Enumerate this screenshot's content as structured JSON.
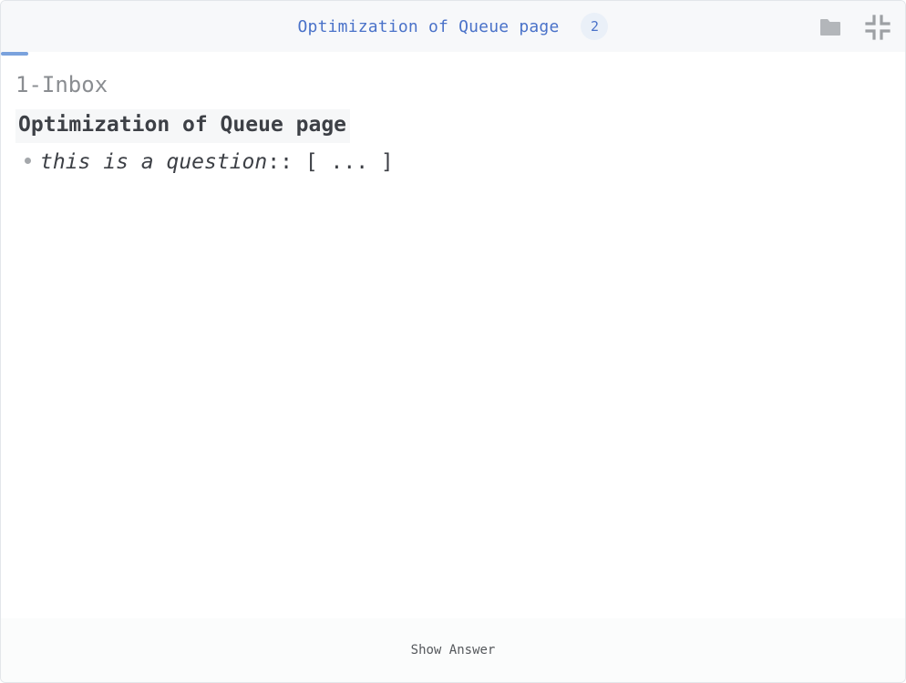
{
  "header": {
    "title": "Optimization of Queue page",
    "count": "2",
    "actions": [
      {
        "icon": "folder-icon"
      },
      {
        "icon": "collapse-icon"
      }
    ]
  },
  "progress": {
    "fraction": 0.03,
    "color": "#7aa2dd"
  },
  "card": {
    "deck": "1-Inbox",
    "block_title": "Optimization of Queue page",
    "bullets": [
      {
        "question": "this is a question",
        "separator": "::",
        "cloze": "[ ... ]"
      }
    ]
  },
  "footer": {
    "show_answer_label": "Show Answer"
  },
  "colors": {
    "accent": "#4a72c9",
    "header_bg": "#f7f8fa",
    "text": "#3d4046",
    "muted": "#8a8d91"
  }
}
